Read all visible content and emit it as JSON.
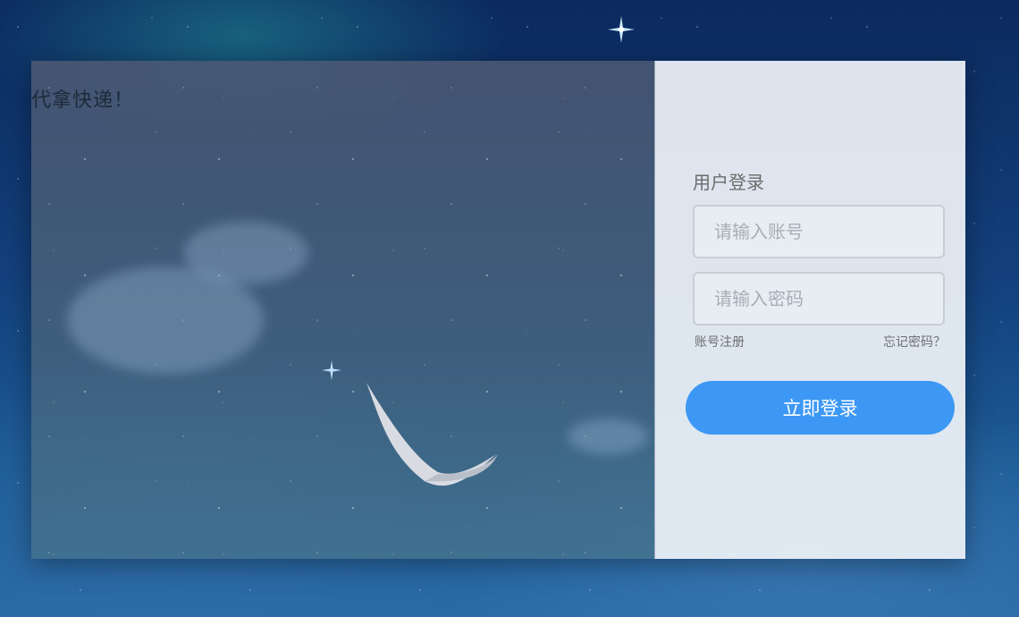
{
  "brand": {
    "title": "代拿快递！"
  },
  "login": {
    "heading": "用户登录",
    "account_placeholder": "请输入账号",
    "password_placeholder": "请输入密码",
    "register_link": "账号注册",
    "forgot_link": "忘记密码？",
    "submit_label": "立即登录"
  },
  "colors": {
    "accent": "#3d98f5",
    "panel": "#eef2f7",
    "background": "#13407c"
  },
  "icons": {
    "background_bird": "bird-illustration",
    "sparkle": "star-glint-icon"
  }
}
